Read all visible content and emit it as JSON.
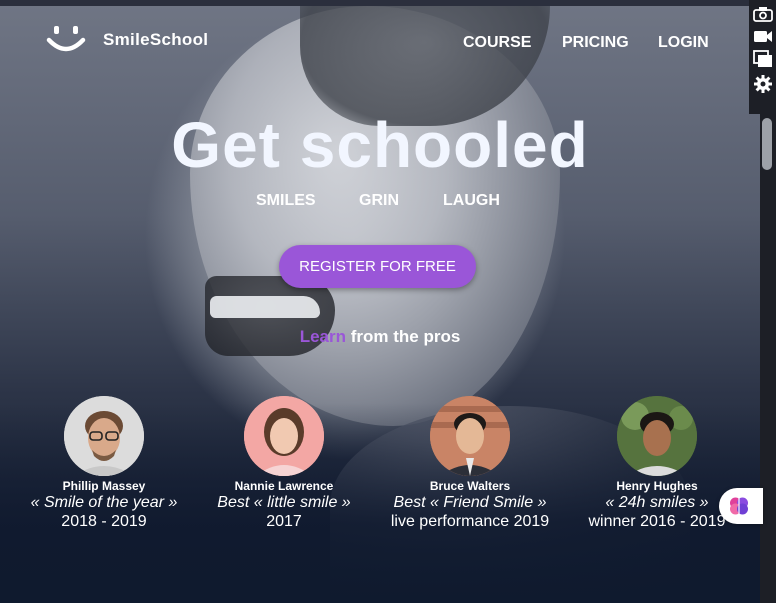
{
  "brand": {
    "name": "SmileSchool",
    "logo_icon": "smile-logo-icon"
  },
  "nav": [
    "COURSE",
    "PRICING",
    "LOGIN"
  ],
  "hero": {
    "title": "Get schooled",
    "subtitles": [
      "SMILES",
      "GRIN",
      "LAUGH"
    ],
    "cta_label": "REGISTER FOR FREE",
    "learn_accent": "Learn",
    "learn_rest": " from the pros"
  },
  "testimonials": [
    {
      "name": "Phillip Massey",
      "quote": "« Smile of the year »",
      "year": "2018 - 2019"
    },
    {
      "name": "Nannie Lawrence",
      "quote": "Best « little smile »",
      "year": "2017"
    },
    {
      "name": "Bruce Walters",
      "quote": "Best « Friend Smile »",
      "year": "live performance 2019"
    },
    {
      "name": "Henry Hughes",
      "quote": "« 24h smiles »",
      "year": "winner 2016 - 2019"
    }
  ],
  "toolbar": {
    "icons": [
      "camera-icon",
      "video-icon",
      "windows-icon",
      "gear-icon"
    ]
  },
  "extension": {
    "icon": "brain-icon"
  },
  "colors": {
    "accent": "#9a56d8",
    "title": "#f2f6ff",
    "background": "#0f1a2e"
  }
}
